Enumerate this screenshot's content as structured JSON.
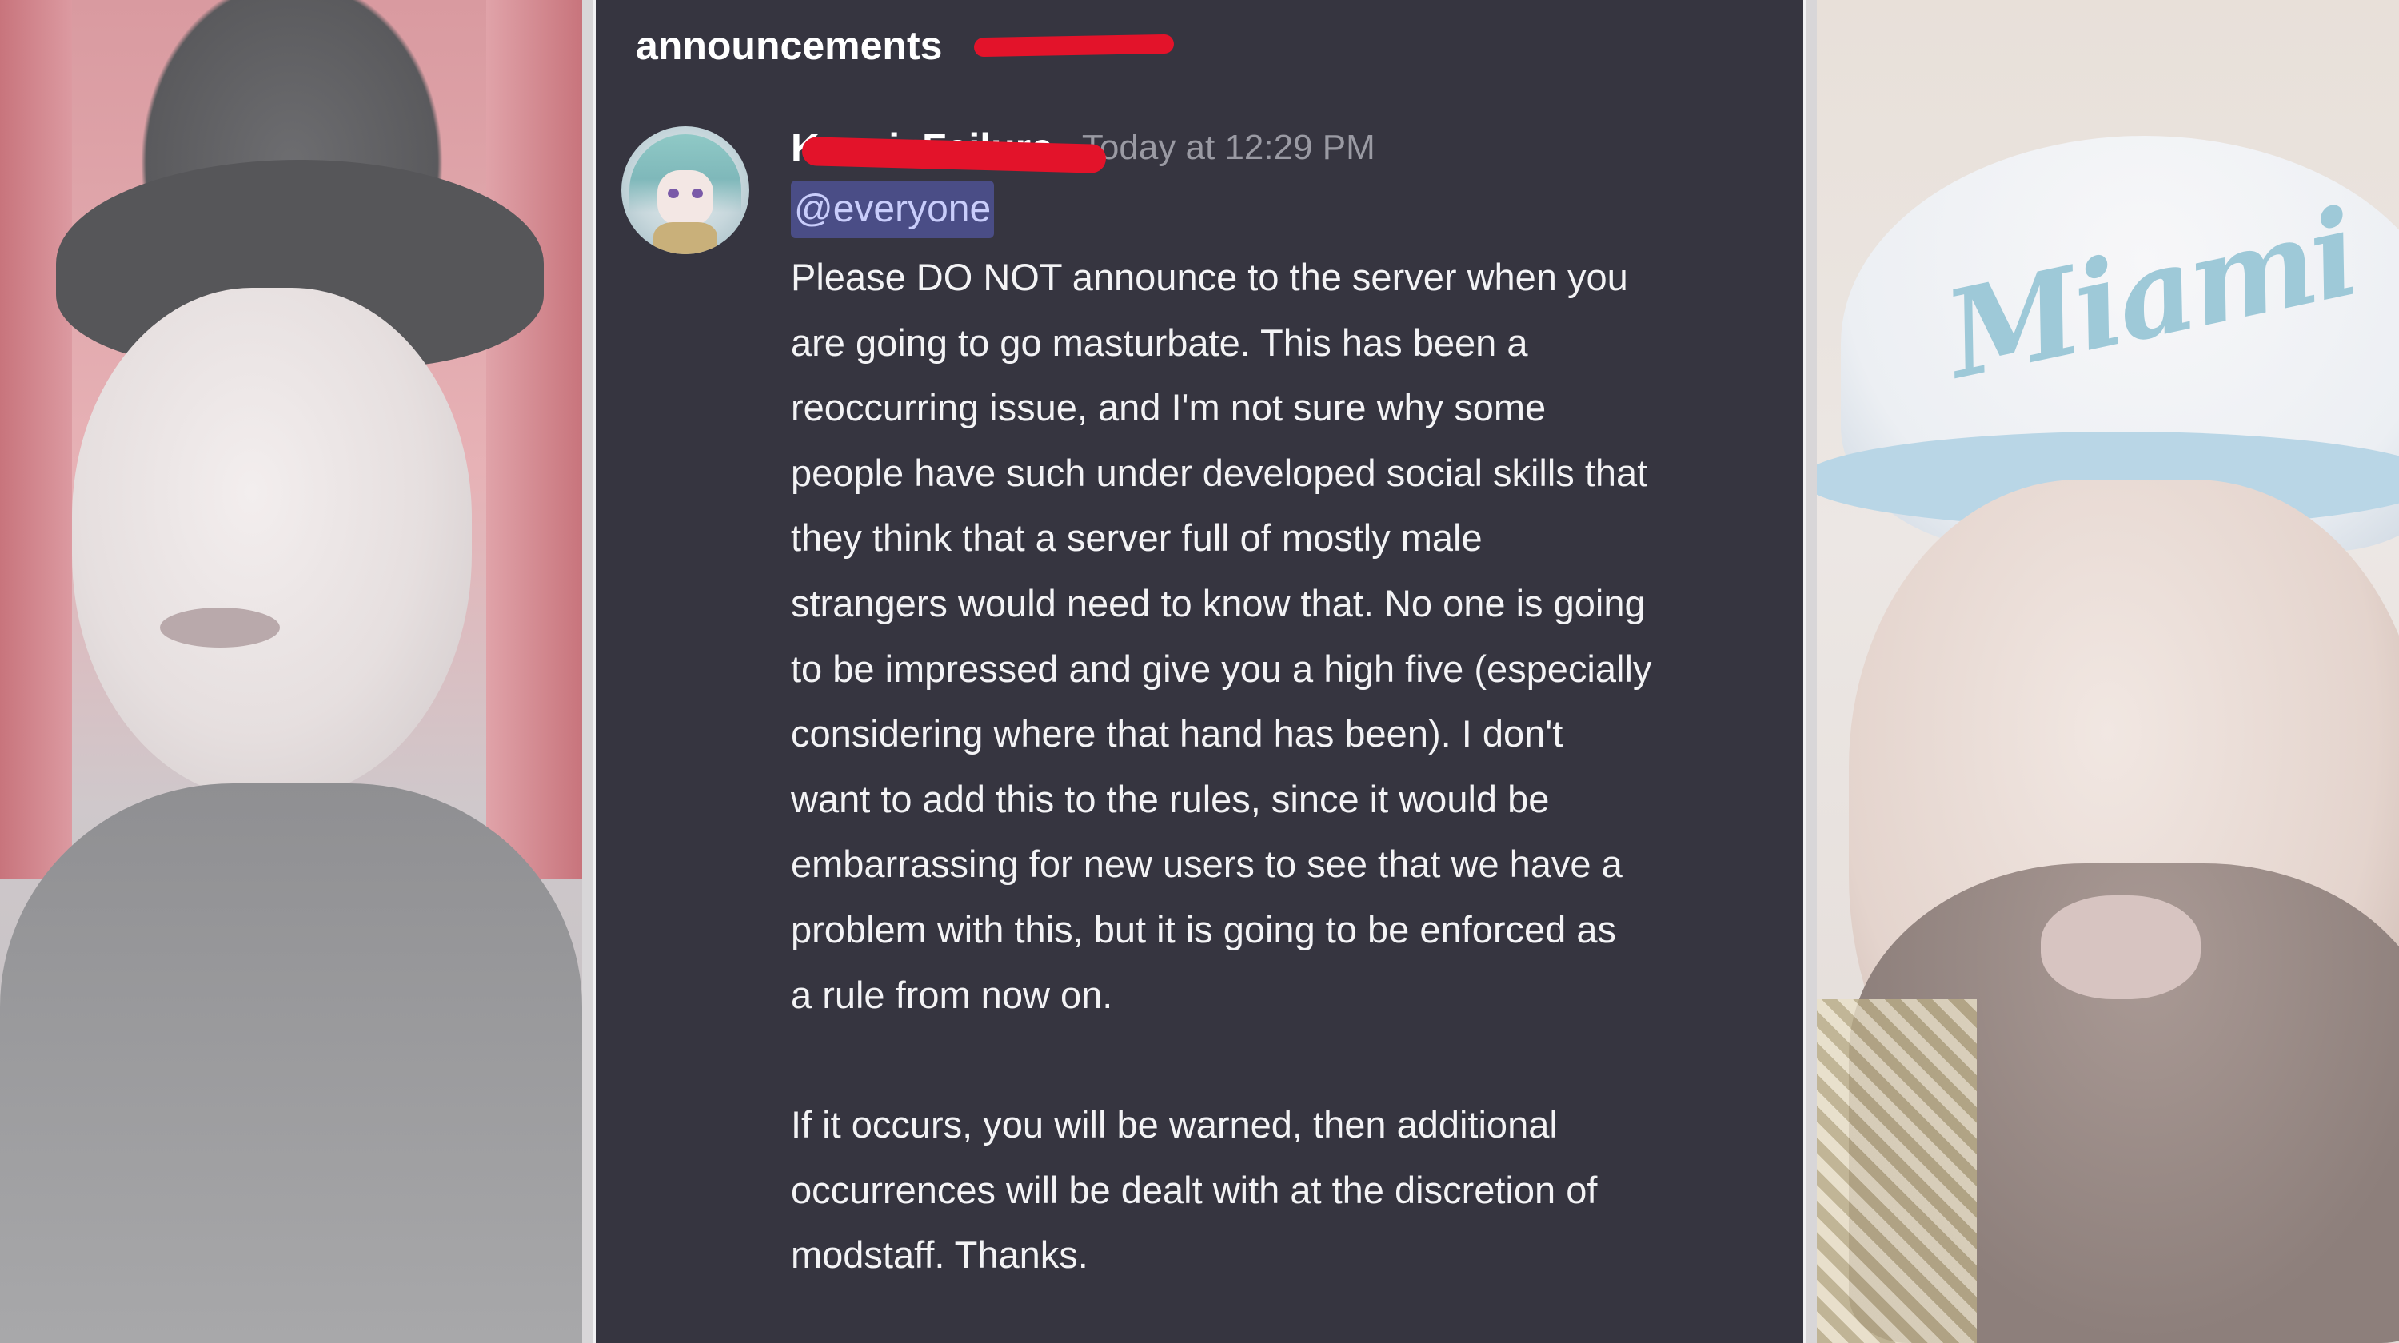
{
  "channel": {
    "name": "announcements"
  },
  "message": {
    "username": "Kenai_Failure",
    "timestamp": "Today at 12:29 PM",
    "mention": "@everyone",
    "paragraphs": [
      "Please DO NOT announce to the server when you\nare going to go masturbate. This has been a\nreoccurring issue, and I'm not sure why some\npeople have such under developed social skills that\nthey think that a server full of mostly male\nstrangers would need to know that. No one is going\nto be impressed and give you a high five (especially\nconsidering where that hand has been). I don't\nwant to add this to the rules, since it would be\nembarrassing for new users to see that we have a\nproblem with this, but it is going to be enforced as\na rule from now on.",
      "If it occurs, you will be warned, then additional\noccurrences will be dealt with at the discretion of\nmodstaff. Thanks."
    ]
  },
  "right_photo": {
    "cap_text": "Miami"
  },
  "colors": {
    "discord_bg": "#363540",
    "mention_bg": "#4a4d86",
    "mention_text": "#c9cdfb",
    "redaction": "#e3132a",
    "timestamp": "#9a9aa3"
  }
}
